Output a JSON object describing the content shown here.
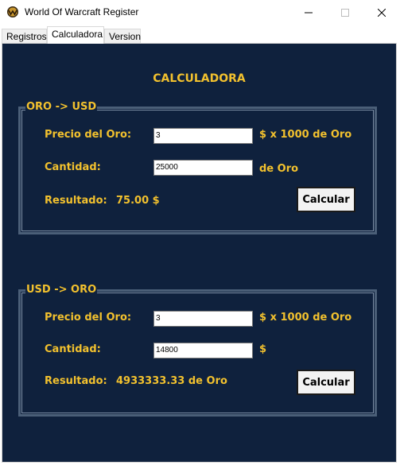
{
  "window": {
    "title": "World Of Warcraft Register",
    "icon": "wow-logo-icon"
  },
  "tabs": [
    {
      "label": "Registros",
      "active": false
    },
    {
      "label": "Calculadora",
      "active": true
    },
    {
      "label": "Version",
      "active": false
    }
  ],
  "calculator": {
    "heading": "CALCULADORA",
    "oro_to_usd": {
      "legend": "ORO -> USD",
      "price_label": "Precio del Oro:",
      "price_value": "3",
      "price_unit": "$ x 1000 de Oro",
      "quantity_label": "Cantidad:",
      "quantity_value": "25000",
      "quantity_unit": "de Oro",
      "result_label": "Resultado:",
      "result_value": "75.00 $",
      "button_label": "Calcular"
    },
    "usd_to_oro": {
      "legend": "USD -> ORO",
      "price_label": "Precio del Oro:",
      "price_value": "3",
      "price_unit": "$ x 1000 de Oro",
      "quantity_label": "Cantidad:",
      "quantity_value": "14800",
      "quantity_unit": "$",
      "result_label": "Resultado:",
      "result_value": "4933333.33 de Oro",
      "button_label": "Calcular"
    }
  },
  "colors": {
    "background": "#0f213d",
    "accent_text": "#f2c12e",
    "group_border": "#4b5f78"
  }
}
